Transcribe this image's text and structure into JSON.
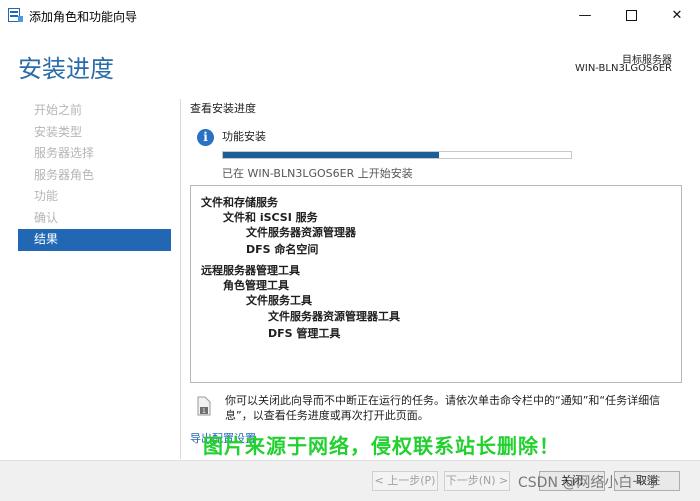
{
  "window": {
    "title": "添加角色和功能向导",
    "minimize_glyph": "—",
    "close_glyph": "✕"
  },
  "header": {
    "title": "安装进度",
    "target_label": "目标服务器",
    "target_value": "WIN-BLN3LGOS6ER"
  },
  "nav": {
    "items": [
      {
        "label": "开始之前",
        "active": false
      },
      {
        "label": "安装类型",
        "active": false
      },
      {
        "label": "服务器选择",
        "active": false
      },
      {
        "label": "服务器角色",
        "active": false
      },
      {
        "label": "功能",
        "active": false
      },
      {
        "label": "确认",
        "active": false
      },
      {
        "label": "结果",
        "active": true
      }
    ]
  },
  "main": {
    "section_title": "查看安装进度",
    "info_glyph": "i",
    "feature_label": "功能安装",
    "progress_fraction": 0.62,
    "status_text": "已在 WIN-BLN3LGOS6ER 上开始安装",
    "results": [
      {
        "text": "文件和存储服务",
        "level": 0
      },
      {
        "text": "文件和 iSCSI 服务",
        "level": 1
      },
      {
        "text": "文件服务器资源管理器",
        "level": 2
      },
      {
        "text": "DFS 命名空间",
        "level": 2
      },
      {
        "text": "远程服务器管理工具",
        "level": 0
      },
      {
        "text": "角色管理工具",
        "level": 1
      },
      {
        "text": "文件服务工具",
        "level": 2
      },
      {
        "text": "文件服务器资源管理器工具",
        "level": 3
      },
      {
        "text": "DFS 管理工具",
        "level": 3
      }
    ],
    "note_text": "你可以关闭此向导而不中断正在运行的任务。请依次单击命令栏中的“通知”和“任务详细信息”，以查看任务进度或再次打开此页面。",
    "export_link": "导出配置设置",
    "overlay_text": "图片来源于网络，侵权联系站长删除！"
  },
  "footer": {
    "prev": "< 上一步(P)",
    "next": "下一步(N) >",
    "close": "关闭",
    "cancel": "取消"
  },
  "csdn_watermark": "CSDN @网络小白一李"
}
